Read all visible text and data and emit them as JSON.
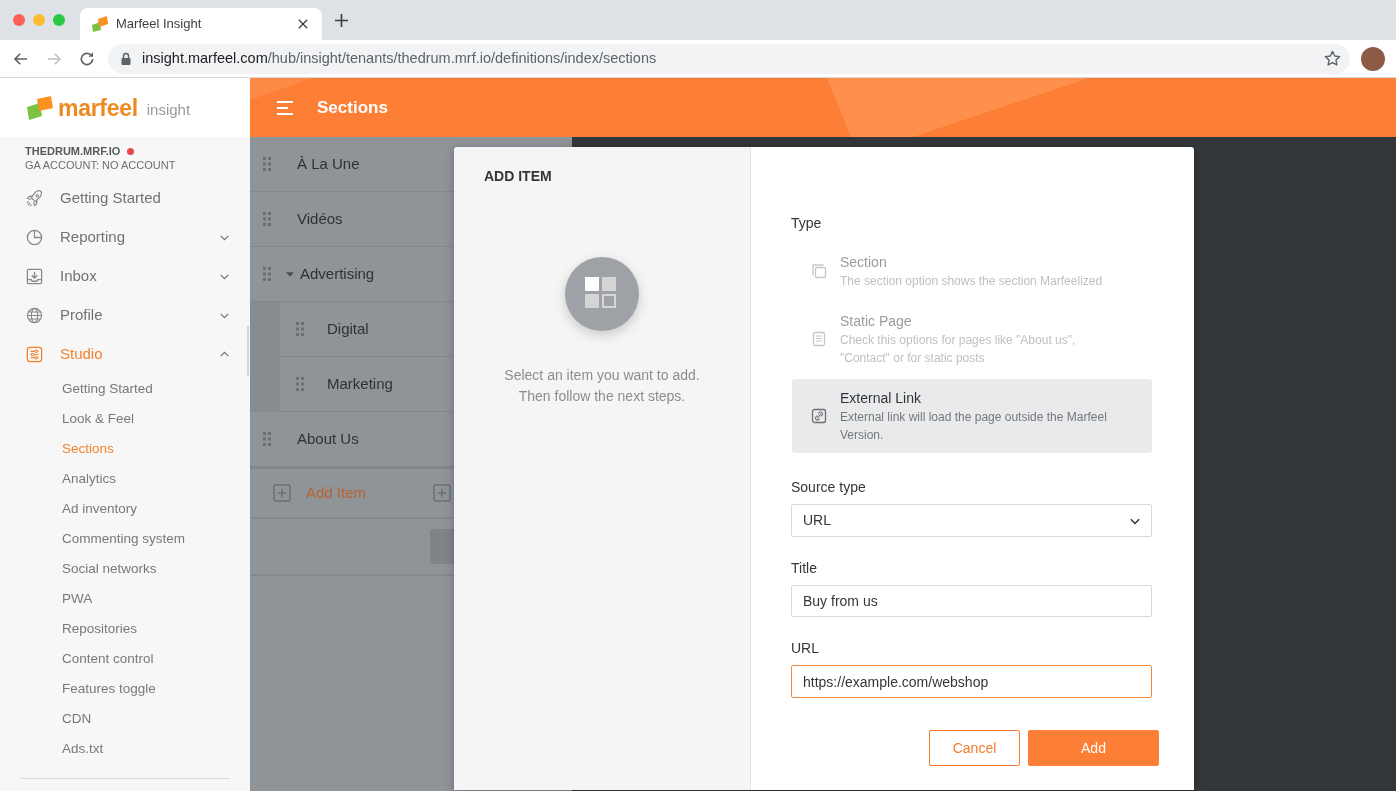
{
  "browser": {
    "tabs": [
      {
        "title": "Marfeel Insight",
        "selected": true
      }
    ],
    "url": {
      "host": "insight.marfeel.com",
      "path": "/hub/insight/tenants/thedrum.mrf.io/definitions/index/sections"
    }
  },
  "sidebar": {
    "logo": {
      "brand": "marfeel",
      "product": "insight"
    },
    "account": {
      "tenant": "THEDRUM.MRF.IO",
      "alert": true,
      "ga_account": "GA ACCOUNT: NO ACCOUNT"
    },
    "nav": [
      {
        "label": "Getting Started",
        "kind": "link",
        "selected": false
      },
      {
        "label": "Reporting",
        "kind": "group",
        "selected": false,
        "expanded": false
      },
      {
        "label": "Inbox",
        "kind": "group",
        "selected": false,
        "expanded": false
      },
      {
        "label": "Profile",
        "kind": "group",
        "selected": false,
        "expanded": false
      },
      {
        "label": "Studio",
        "kind": "group",
        "selected": true,
        "expanded": true,
        "children": [
          {
            "label": "Getting Started",
            "selected": false
          },
          {
            "label": "Look & Feel",
            "selected": false
          },
          {
            "label": "Sections",
            "selected": true
          },
          {
            "label": "Analytics",
            "selected": false
          },
          {
            "label": "Ad inventory",
            "selected": false
          },
          {
            "label": "Commenting system",
            "selected": false
          },
          {
            "label": "Social networks",
            "selected": false
          },
          {
            "label": "PWA",
            "selected": false
          },
          {
            "label": "Repositories",
            "selected": false
          },
          {
            "label": "Content control",
            "selected": false
          },
          {
            "label": "Features toggle",
            "selected": false
          },
          {
            "label": "CDN",
            "selected": false
          },
          {
            "label": "Ads.txt",
            "selected": false
          }
        ]
      }
    ]
  },
  "header": {
    "title": "Sections"
  },
  "sections": {
    "items": [
      {
        "label": "À La Une"
      },
      {
        "label": "Vidéos"
      },
      {
        "label": "Advertising",
        "expanded": true,
        "children": [
          {
            "label": "Digital"
          },
          {
            "label": "Marketing"
          }
        ]
      },
      {
        "label": "About Us"
      }
    ],
    "add_label": "Add Item"
  },
  "modal": {
    "title": "ADD ITEM",
    "hint_lines": [
      "Select an item you want to add.",
      "Then follow the next steps."
    ],
    "type": {
      "label": "Type",
      "options": [
        {
          "title": "Section",
          "description": "The section option shows the section Marfeelized",
          "selected": false
        },
        {
          "title": "Static Page",
          "description": "Check this options for pages like \"About us\", \"Contact\" or for static posts",
          "selected": false
        },
        {
          "title": "External Link",
          "description": "External link will load the page outside the Marfeel Version.",
          "selected": true
        }
      ]
    },
    "source_type": {
      "label": "Source type",
      "value": "URL"
    },
    "title_field": {
      "label": "Title",
      "value": "Buy from us"
    },
    "url_field": {
      "label": "URL",
      "value": "https://example.com/webshop",
      "focused": true
    },
    "buttons": [
      {
        "label": "Cancel",
        "kind": "secondary"
      },
      {
        "label": "Add",
        "kind": "primary"
      }
    ]
  }
}
